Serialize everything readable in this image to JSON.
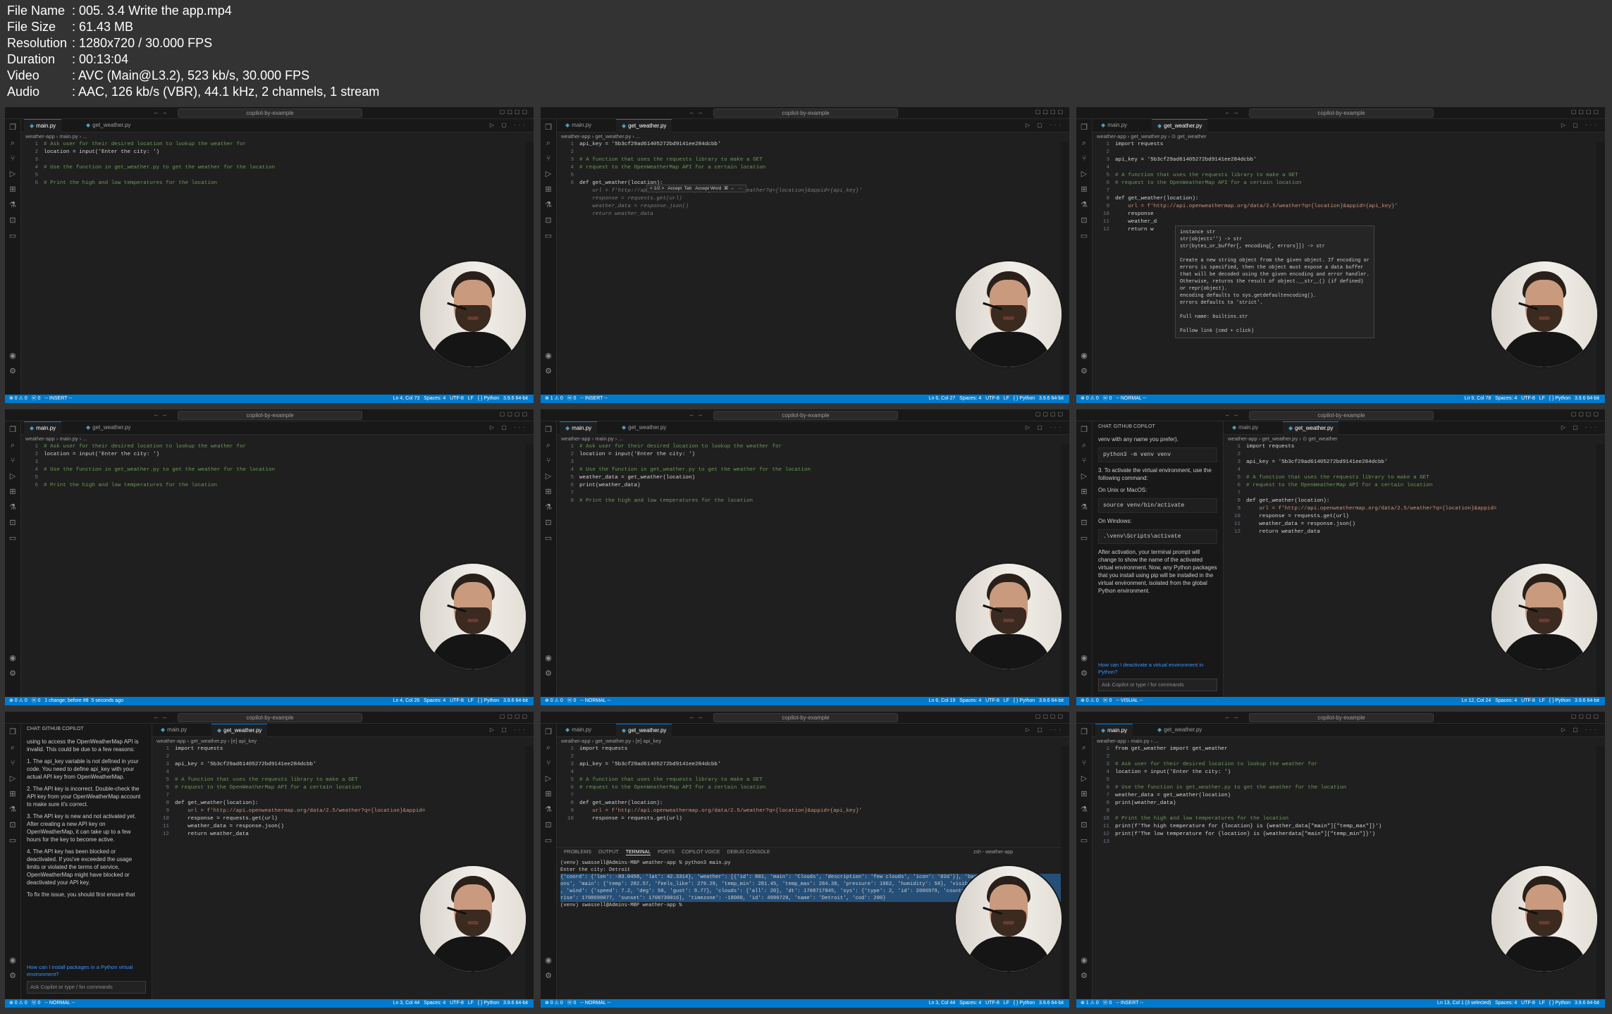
{
  "info": {
    "rows": [
      {
        "key": "File Name",
        "value": "005. 3.4 Write the app.mp4"
      },
      {
        "key": "File Size",
        "value": "61.43 MB"
      },
      {
        "key": "Resolution",
        "value": "1280x720 / 30.000 FPS"
      },
      {
        "key": "Duration",
        "value": "00:13:04"
      },
      {
        "key": "Video",
        "value": "AVC (Main@L3.2), 523 kb/s, 30.000 FPS"
      },
      {
        "key": "Audio",
        "value": "AAC, 126 kb/s (VBR), 44.1 kHz, 2 channels, 1 stream"
      }
    ]
  },
  "window_search": "copilot-by-example",
  "tabs": {
    "main": "main.py",
    "get_weather": "get_weather.py"
  },
  "frames": [
    {
      "active_tab": "main",
      "crumb": "weather-app › main.py › ...",
      "status_left": "⊗ 0 ⚠ 0   ⓦ 0   -- INSERT --",
      "status_right": "Ln 4, Col 73   Spaces: 4   UTF-8   LF   { } Python   3.9.6 64-bit",
      "lines": [
        {
          "n": "1",
          "t": "# Ask user for their desired location to lookup the weather for",
          "c": "c-com"
        },
        {
          "n": "2",
          "t": "location = input('Enter the city: ')",
          "c": "c-plain"
        },
        {
          "n": "3",
          "t": "",
          "c": "c-plain"
        },
        {
          "n": "4",
          "t": "# Use the function in get_weather.py to get the weather for the location",
          "c": "c-com"
        },
        {
          "n": "5",
          "t": "",
          "c": "c-plain"
        },
        {
          "n": "6",
          "t": "# Print the high and low temperatures for the location",
          "c": "c-com"
        }
      ]
    },
    {
      "active_tab": "get_weather",
      "crumb": "weather-app › get_weather.py › ...",
      "status_left": "⊗ 1 ⚠ 0   ⓦ 0   -- INSERT --",
      "status_right": "Ln 6, Col 27   Spaces: 4   UTF-8   LF   { } Python   3.9.6 64-bit",
      "inline_widget": "< 1/2 >   Accept  Tab   Accept Word  ⌘ →   ···",
      "lines": [
        {
          "n": "1",
          "t": "api_key = '5b3cf29ad61405272bd9141ee284dcbb'",
          "c": "c-plain"
        },
        {
          "n": "2",
          "t": "",
          "c": "c-plain"
        },
        {
          "n": "3",
          "t": "# A function that uses the requests library to make a GET",
          "c": "c-com"
        },
        {
          "n": "4",
          "t": "# request to the OpenWeatherMap API for a certain location",
          "c": "c-com"
        },
        {
          "n": "5",
          "t": "",
          "c": "c-plain"
        },
        {
          "n": "6",
          "t": "def get_weather(location):",
          "c": "c-plain"
        },
        {
          "n": "",
          "t": "    url = f'http://api.openweathermap.org/data/2.5/weather?q={location}&appid={api_key}'",
          "c": "ghost"
        },
        {
          "n": "",
          "t": "    response = requests.get(url)",
          "c": "ghost"
        },
        {
          "n": "",
          "t": "    weather_data = response.json()",
          "c": "ghost"
        },
        {
          "n": "",
          "t": "    return weather_data",
          "c": "ghost"
        }
      ]
    },
    {
      "active_tab": "get_weather",
      "crumb": "weather-app › get_weather.py › ⊙ get_weather",
      "status_left": "⊗ 0 ⚠ 0   ⓦ 0   -- NORMAL --",
      "status_right": "Ln 9, Col 78   Spaces: 4   UTF-8   LF   { } Python   3.9.6 64-bit",
      "lines": [
        {
          "n": "1",
          "t": "import requests",
          "c": "c-plain"
        },
        {
          "n": "2",
          "t": "",
          "c": "c-plain"
        },
        {
          "n": "3",
          "t": "api_key = '5b3cf29ad61405272bd9141ee284dcbb'",
          "c": "c-plain"
        },
        {
          "n": "4",
          "t": "",
          "c": "c-plain"
        },
        {
          "n": "5",
          "t": "# A function that uses the requests library to make a GET",
          "c": "c-com"
        },
        {
          "n": "6",
          "t": "# request to the OpenWeatherMap API for a certain location",
          "c": "c-com"
        },
        {
          "n": "7",
          "t": "",
          "c": "c-plain"
        },
        {
          "n": "8",
          "t": "def get_weather(location):",
          "c": "c-plain"
        },
        {
          "n": "9",
          "t": "    url = f'http://api.openweathermap.org/data/2.5/weather?q={location}&appid={api_key}'",
          "c": "c-str"
        },
        {
          "n": "10",
          "t": "    response",
          "c": "c-plain"
        },
        {
          "n": "11",
          "t": "    weather_d",
          "c": "c-plain"
        },
        {
          "n": "12",
          "t": "    return w",
          "c": "c-plain"
        }
      ],
      "hover": "instance str\nstr(object='') -> str\nstr(bytes_or_buffer[, encoding[, errors]]) -> str\n\nCreate a new string object from the given object. If encoding or\nerrors is specified, then the object must expose a data buffer\nthat will be decoded using the given encoding and error handler.\nOtherwise, returns the result of object.__str__() (if defined)\nor repr(object).\nencoding defaults to sys.getdefaultencoding().\nerrors defaults to 'strict'.\n\nFull name: builtins.str\n\nFollow link (cmd + click)"
    },
    {
      "active_tab": "main",
      "crumb": "weather-app › main.py › ...",
      "status_left": "⊗ 0 ⚠ 0   ⓦ 0   1 change; before #8  5 seconds ago",
      "status_right": "Ln 4, Col 26   Spaces: 4   UTF-8   LF   { } Python   3.9.6 64-bit",
      "lines": [
        {
          "n": "1",
          "t": "# Ask user for their desired location to lookup the weather for",
          "c": "c-com"
        },
        {
          "n": "2",
          "t": "location = input('Enter the city: ')",
          "c": "c-plain"
        },
        {
          "n": "3",
          "t": "",
          "c": "c-plain"
        },
        {
          "n": "4",
          "t": "# Use the function in get_weather.py to get the weather for the location",
          "c": "c-com"
        },
        {
          "n": "5",
          "t": "",
          "c": "c-plain"
        },
        {
          "n": "6",
          "t": "# Print the high and low temperatures for the location",
          "c": "c-com"
        }
      ]
    },
    {
      "active_tab": "main",
      "crumb": "weather-app › main.py › ...",
      "status_left": "⊗ 0 ⚠ 0   ⓦ 0   -- NORMAL --",
      "status_right": "Ln 6, Col 19   Spaces: 4   UTF-8   LF   { } Python   3.9.6 64-bit",
      "lines": [
        {
          "n": "1",
          "t": "# Ask user for their desired location to lookup the weather for",
          "c": "c-com"
        },
        {
          "n": "2",
          "t": "location = input('Enter the city: ')",
          "c": "c-plain"
        },
        {
          "n": "3",
          "t": "",
          "c": "c-plain"
        },
        {
          "n": "4",
          "t": "# Use the function in get_weather.py to get the weather for the location",
          "c": "c-com"
        },
        {
          "n": "5",
          "t": "weather_data = get_weather(location)",
          "c": "c-plain"
        },
        {
          "n": "6",
          "t": "print(weather_data)",
          "c": "c-plain"
        },
        {
          "n": "7",
          "t": "",
          "c": "c-plain"
        },
        {
          "n": "8",
          "t": "# Print the high and low temperatures for the location",
          "c": "c-com"
        }
      ]
    },
    {
      "active_tab": "get_weather",
      "crumb": "weather-app › get_weather.py › ⊙ get_weather",
      "status_left": "⊗ 0 ⚠ 0   ⓦ 0   -- VISUAL --",
      "status_right": "Ln 12, Col 24   Spaces: 4   UTF-8   LF   { } Python   3.9.6 64-bit",
      "panel": {
        "header": "CHAT: GITHUB COPILOT",
        "p1": "venv with any name you prefer).",
        "code1": "python3 -m venv venv",
        "p2": "3. To activate the virtual environment, use the following command:",
        "p3": "On Unix or MacOS:",
        "code2": "source venv/bin/activate",
        "p4": "On Windows:",
        "code3": ".\\venv\\Scripts\\activate",
        "p5": "After activation, your terminal prompt will change to show the name of the activated virtual environment. Now, any Python packages that you install using pip will be installed in the virtual environment, isolated from the global Python environment.",
        "suggestion": "How can I deactivate a virtual environment in Python?",
        "ask": "Ask Copilot or type / for commands"
      },
      "lines": [
        {
          "n": "1",
          "t": "import requests",
          "c": "c-plain"
        },
        {
          "n": "2",
          "t": "",
          "c": "c-plain"
        },
        {
          "n": "3",
          "t": "api_key = '5b3cf29ad61405272bd9141ee284dcbb'",
          "c": "c-plain"
        },
        {
          "n": "4",
          "t": "",
          "c": "c-plain"
        },
        {
          "n": "5",
          "t": "# A function that uses the requests library to make a GET",
          "c": "c-com"
        },
        {
          "n": "6",
          "t": "# request to the OpenWeatherMap API for a certain location",
          "c": "c-com"
        },
        {
          "n": "7",
          "t": "",
          "c": "c-plain"
        },
        {
          "n": "8",
          "t": "def get_weather(location):",
          "c": "c-plain"
        },
        {
          "n": "9",
          "t": "    url = f'http://api.openweathermap.org/data/2.5/weather?q={location}&appid=",
          "c": "c-str"
        },
        {
          "n": "10",
          "t": "    response = requests.get(url)",
          "c": "c-plain"
        },
        {
          "n": "11",
          "t": "    weather_data = response.json()",
          "c": "c-plain"
        },
        {
          "n": "12",
          "t": "    return weather_data",
          "c": "c-plain"
        }
      ]
    },
    {
      "active_tab": "get_weather",
      "crumb": "weather-app › get_weather.py › [e] api_key",
      "status_left": "⊗ 0 ⚠ 0   ⓦ 0   -- NORMAL --",
      "status_right": "Ln 3, Col 44   Spaces: 4   UTF-8   LF   { } Python   3.9.6 64-bit",
      "panel": {
        "header": "CHAT: GITHUB COPILOT",
        "p0": "using to access the OpenWeatherMap API is invalid. This could be due to a few reasons:",
        "li1": "1. The api_key variable is not defined in your code. You need to define api_key with your actual API key from OpenWeatherMap.",
        "li2": "2. The API key is incorrect. Double-check the API key from your OpenWeatherMap account to make sure it's correct.",
        "li3": "3. The API key is new and not activated yet. After creating a new API key on OpenWeatherMap, it can take up to a few hours for the key to become active.",
        "li4": "4. The API key has been blocked or deactivated. If you've exceeded the usage limits or violated the terms of service, OpenWeatherMap might have blocked or deactivated your API key.",
        "p6": "To fix the issue, you should first ensure that",
        "suggestion": "How can I install packages in a Python virtual environment?",
        "ask": "Ask Copilot or type / for commands"
      },
      "lines": [
        {
          "n": "1",
          "t": "import requests",
          "c": "c-plain"
        },
        {
          "n": "2",
          "t": "",
          "c": "c-plain"
        },
        {
          "n": "3",
          "t": "api_key = '5b3cf29ad61405272bd9141ee284dcbb'",
          "c": "c-plain"
        },
        {
          "n": "4",
          "t": "",
          "c": "c-plain"
        },
        {
          "n": "5",
          "t": "# A function that uses the requests library to make a GET",
          "c": "c-com"
        },
        {
          "n": "6",
          "t": "# request to the OpenWeatherMap API for a certain location",
          "c": "c-com"
        },
        {
          "n": "7",
          "t": "",
          "c": "c-plain"
        },
        {
          "n": "8",
          "t": "def get_weather(location):",
          "c": "c-plain"
        },
        {
          "n": "9",
          "t": "    url = f'http://api.openweathermap.org/data/2.5/weather?q={location}&appid=",
          "c": "c-str"
        },
        {
          "n": "10",
          "t": "    response = requests.get(url)",
          "c": "c-plain"
        },
        {
          "n": "11",
          "t": "    weather_data = response.json()",
          "c": "c-plain"
        },
        {
          "n": "12",
          "t": "    return weather_data",
          "c": "c-plain"
        }
      ]
    },
    {
      "active_tab": "get_weather",
      "crumb": "weather-app › get_weather.py › [e] api_key",
      "status_left": "⊗ 0 ⚠ 0   ⓦ 0   -- NORMAL --",
      "status_right": "Ln 3, Col 44   Spaces: 4   UTF-8   LF   { } Python   3.9.6 64-bit",
      "terminal_tabs": [
        "PROBLEMS",
        "OUTPUT",
        "TERMINAL",
        "PORTS",
        "COPILOT VOICE",
        "DEBUG CONSOLE"
      ],
      "terminal_title": "zsh - weather-app",
      "terminal": [
        "(venv) swassell@Admins-MBP weather-app % python3 main.py",
        "Enter the city: Detroit",
        "{'coord': {'lon': -83.0458, 'lat': 42.3314}, 'weather': [{'id': 801, 'main': 'Clouds', 'description': 'few clouds', 'icon': '02d'}], 'base': 'stati",
        "ons', 'main': {'temp': 282.57, 'feels_like': 279.29, 'temp_min': 281.45, 'temp_max': 284.38, 'pressure': 1002, 'humidity': 58}, 'visibility': 10000",
        ", 'wind': {'speed': 7.2, 'deg': 50, 'gust': 9.77}, 'clouds': {'all': 20}, 'dt': 1708717845, 'sys': {'type': 2, 'id': 2006979, 'country': 'US', 'sun",
        "rise': 1708690077, 'sunset': 1708730016}, 'timezone': -18000, 'id': 4990729, 'name': 'Detroit', 'cod': 200}",
        "(venv) swassell@Admins-MBP weather-app % "
      ],
      "lines": [
        {
          "n": "1",
          "t": "import requests",
          "c": "c-plain"
        },
        {
          "n": "2",
          "t": "",
          "c": "c-plain"
        },
        {
          "n": "3",
          "t": "api_key = '5b3cf29ad61405272bd9141ee284dcbb'",
          "c": "c-plain"
        },
        {
          "n": "4",
          "t": "",
          "c": "c-plain"
        },
        {
          "n": "5",
          "t": "# A function that uses the requests library to make a GET",
          "c": "c-com"
        },
        {
          "n": "6",
          "t": "# request to the OpenWeatherMap API for a certain location",
          "c": "c-com"
        },
        {
          "n": "7",
          "t": "",
          "c": "c-plain"
        },
        {
          "n": "8",
          "t": "def get_weather(location):",
          "c": "c-plain"
        },
        {
          "n": "9",
          "t": "    url = f'http://api.openweathermap.org/data/2.5/weather?q={location}&appid={api_key}'",
          "c": "c-str"
        },
        {
          "n": "10",
          "t": "    response = requests.get(url)",
          "c": "c-plain"
        }
      ]
    },
    {
      "active_tab": "main",
      "crumb": "weather-app › main.py › ...",
      "status_left": "⊗ 1 ⚠ 0   ⓦ 0   -- INSERT --",
      "status_right": "Ln 13, Col 1 (3 selected)   Spaces: 4   UTF-8   LF   { } Python   3.9.6 64-bit",
      "lines": [
        {
          "n": "1",
          "t": "from get_weather import get_weather",
          "c": "c-plain"
        },
        {
          "n": "2",
          "t": "",
          "c": "c-plain"
        },
        {
          "n": "3",
          "t": "# Ask user for their desired location to lookup the weather for",
          "c": "c-com"
        },
        {
          "n": "4",
          "t": "location = input('Enter the city: ')",
          "c": "c-plain"
        },
        {
          "n": "5",
          "t": "",
          "c": "c-plain"
        },
        {
          "n": "6",
          "t": "# Use the function in get_weather.py to get the weather for the location",
          "c": "c-com"
        },
        {
          "n": "7",
          "t": "weather_data = get_weather(location)",
          "c": "c-plain"
        },
        {
          "n": "8",
          "t": "print(weather_data)",
          "c": "c-plain"
        },
        {
          "n": "9",
          "t": "",
          "c": "c-plain"
        },
        {
          "n": "10",
          "t": "# Print the high and low temperatures for the location",
          "c": "c-com"
        },
        {
          "n": "11",
          "t": "print(f'The high temperature for {location} is {weather_data[\"main\"][\"temp_max\"]}')",
          "c": "c-plain"
        },
        {
          "n": "12",
          "t": "print(f'The low temperature for {location} is {weatherdata[\"main\"][\"temp_min\"]}')",
          "c": "c-plain"
        },
        {
          "n": "13",
          "t": "",
          "c": "c-plain"
        }
      ]
    }
  ]
}
